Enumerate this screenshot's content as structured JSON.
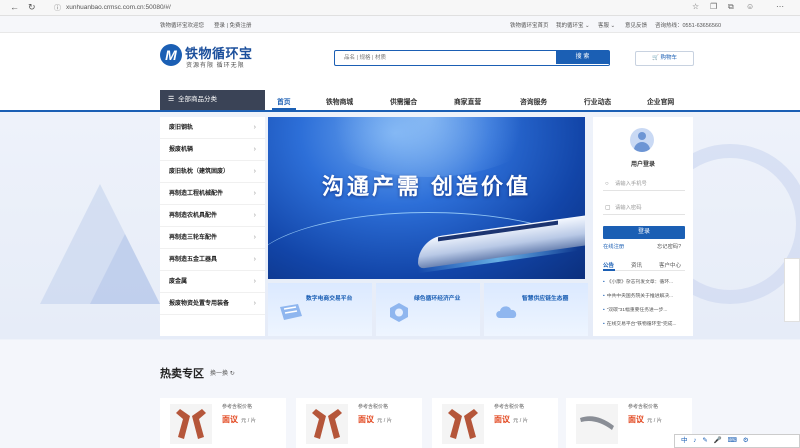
{
  "browser": {
    "url": "xunhuanbao.crmsc.com.cn:50080/#/",
    "icons": [
      "back-icon",
      "refresh-icon",
      "lock-icon",
      "favorite-icon",
      "collections-icon",
      "extensions-icon",
      "profile-icon",
      "more-icon"
    ]
  },
  "topbar": {
    "welcome": "铁物循环宝欢迎您",
    "auth": "登录 | 免费注册",
    "home": "铁物循环宝首页",
    "my": "我的循环宝 ⌄",
    "service": "客服 ⌄",
    "feedback": "意见反馈",
    "hotline": "咨询热线：0551-63656560"
  },
  "header": {
    "logo_mark": "M",
    "logo_name": "铁物循环宝",
    "slogan": "资源有限   循环无限",
    "search_placeholder": "品名 | 规格 | 材质",
    "search_button": "搜 索",
    "cart": "购物车"
  },
  "nav": {
    "category_header": "全部商品分类",
    "items": [
      "首页",
      "铁物商城",
      "供需撮合",
      "商家直营",
      "咨询服务",
      "行业动态",
      "企业官网"
    ]
  },
  "categories": [
    "废旧钢轨",
    "报废机辆",
    "废旧轨枕（建筑固废）",
    "再制造工程机械配件",
    "再制造农机具配件",
    "再制造三轮车配件",
    "再制造五金工器具",
    "废金属",
    "报废物资处置专用装备"
  ],
  "banner": {
    "slogan": "沟通产需  创造价值"
  },
  "features": [
    {
      "title": "数字电商交易平台"
    },
    {
      "title": "绿色循环经济产业"
    },
    {
      "title": "智慧供应链生态圈"
    }
  ],
  "user_panel": {
    "title": "用户登录",
    "phone_placeholder": "请输入手机号",
    "password_placeholder": "请输入密码",
    "login_button": "登录",
    "register": "在线注册",
    "forgot": "忘记密码?",
    "tabs": [
      "公告",
      "资讯",
      "客户中心"
    ],
    "news": [
      "《小康》杂志刊发文章：循环...",
      "中共中央国务院关于推进解决...",
      "\"双碳\"31幅重要任务进一步...",
      "在线交易平台\"铁物循环宝\"完成..."
    ]
  },
  "hot": {
    "title": "热卖专区",
    "more": "换一换",
    "products": [
      {
        "ref": "参考含税价格",
        "price": "面议",
        "unit": "元 / 片"
      },
      {
        "ref": "参考含税价格",
        "price": "面议",
        "unit": "元 / 片"
      },
      {
        "ref": "参考含税价格",
        "price": "面议",
        "unit": "元 / 片"
      },
      {
        "ref": "参考含税价格",
        "price": "面议",
        "unit": "元 / 片"
      }
    ]
  },
  "taskbar": {
    "text": "中 ♪ ✎ 🎤 ⌨ ⚙"
  }
}
